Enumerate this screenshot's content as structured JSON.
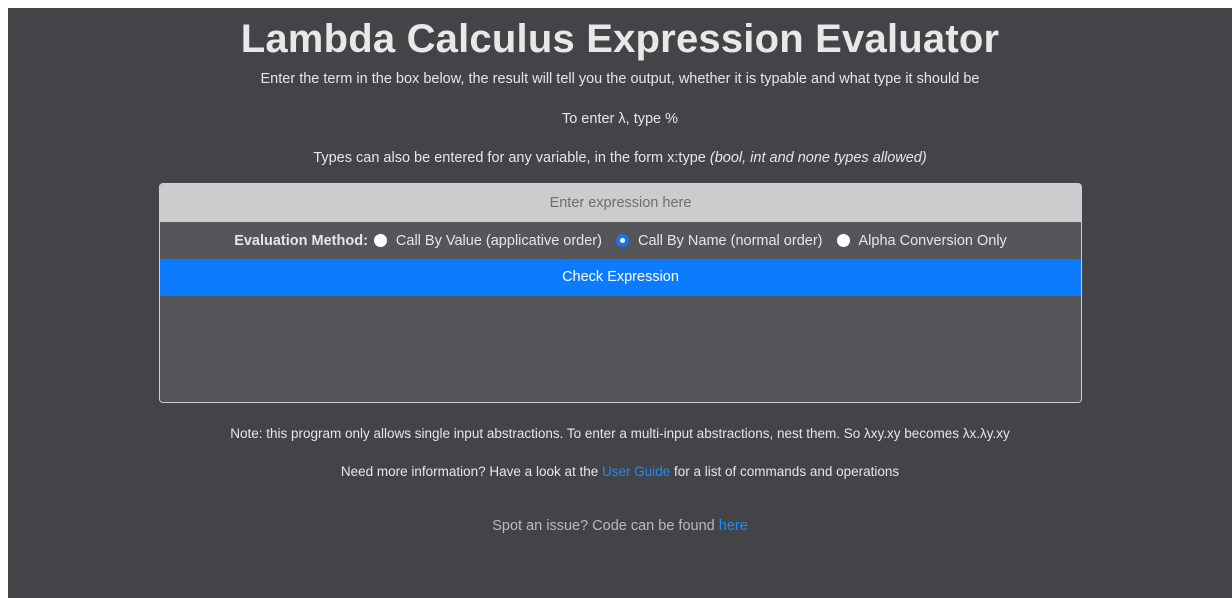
{
  "header": {
    "title": "Lambda Calculus Expression Evaluator"
  },
  "intro": {
    "line1": "Enter the term in the box below, the result will tell you the output, whether it is typable and what type it should be",
    "line2": "To enter λ, type %",
    "line3_text": "Types can also be entered for any variable, in the form x:type ",
    "line3_emphasis": "(bool, int and none types allowed)"
  },
  "form": {
    "expression": {
      "placeholder": "Enter expression here",
      "value": ""
    },
    "method_label": "Evaluation Method:",
    "methods": [
      {
        "label": "Call By Value (applicative order)",
        "checked": false
      },
      {
        "label": "Call By Name (normal order)",
        "checked": true
      },
      {
        "label": "Alpha Conversion Only",
        "checked": false
      }
    ],
    "submit_label": "Check Expression",
    "output": ""
  },
  "footer": {
    "note": "Note: this program only allows single input abstractions. To enter a multi-input abstractions, nest them. So λxy.xy becomes λx.λy.xy",
    "info_before": "Need more information? Have a look at the ",
    "info_link": "User Guide",
    "info_after": " for a list of commands and operations",
    "spot_before": "Spot an issue? Code can be found ",
    "spot_link": "here"
  },
  "colors": {
    "page_background": "#434447",
    "panel_background": "#555659",
    "input_background": "#cbcccd",
    "button_background": "#0d7bfe",
    "link": "#1a8cff"
  }
}
